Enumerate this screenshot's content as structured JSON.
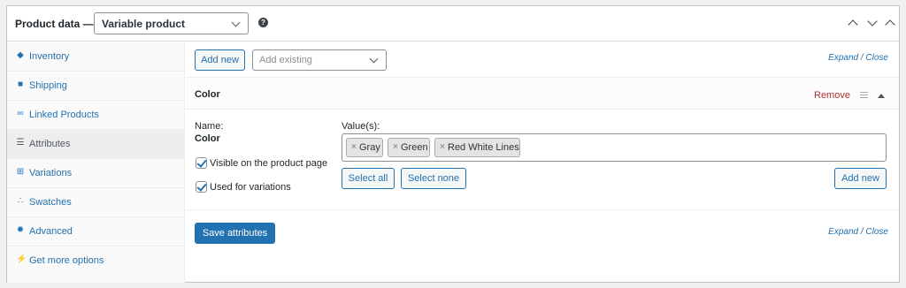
{
  "header": {
    "title": "Product data —",
    "product_type": "Variable product",
    "help_glyph": "?"
  },
  "sidebar": {
    "items": [
      {
        "label": "Inventory",
        "icon": "tag-icon"
      },
      {
        "label": "Shipping",
        "icon": "truck-icon"
      },
      {
        "label": "Linked Products",
        "icon": "link-icon"
      },
      {
        "label": "Attributes",
        "icon": "list-icon",
        "active": true
      },
      {
        "label": "Variations",
        "icon": "grid-icon"
      },
      {
        "label": "Swatches",
        "icon": "dots-icon"
      },
      {
        "label": "Advanced",
        "icon": "gear-icon"
      },
      {
        "label": "Get more options",
        "icon": "plug-icon"
      }
    ]
  },
  "toolbar": {
    "add_new_label": "Add new",
    "add_existing_placeholder": "Add existing",
    "expand_label": "Expand",
    "close_label": "Close"
  },
  "attribute": {
    "name": "Color",
    "remove_label": "Remove",
    "name_label": "Name:",
    "name_value": "Color",
    "visible_label": "Visible on the product page",
    "visible_checked": true,
    "variations_label": "Used for variations",
    "variations_checked": true,
    "values_label": "Value(s):",
    "values": [
      "Gray",
      "Green",
      "Red White Lines"
    ],
    "select_all_label": "Select all",
    "select_none_label": "Select none",
    "add_new_label": "Add new"
  },
  "footer": {
    "save_label": "Save attributes",
    "expand_label": "Expand",
    "close_label": "Close"
  },
  "colors": {
    "link": "#2271b1",
    "danger": "#b32d2e",
    "primary_button": "#2271b1"
  }
}
